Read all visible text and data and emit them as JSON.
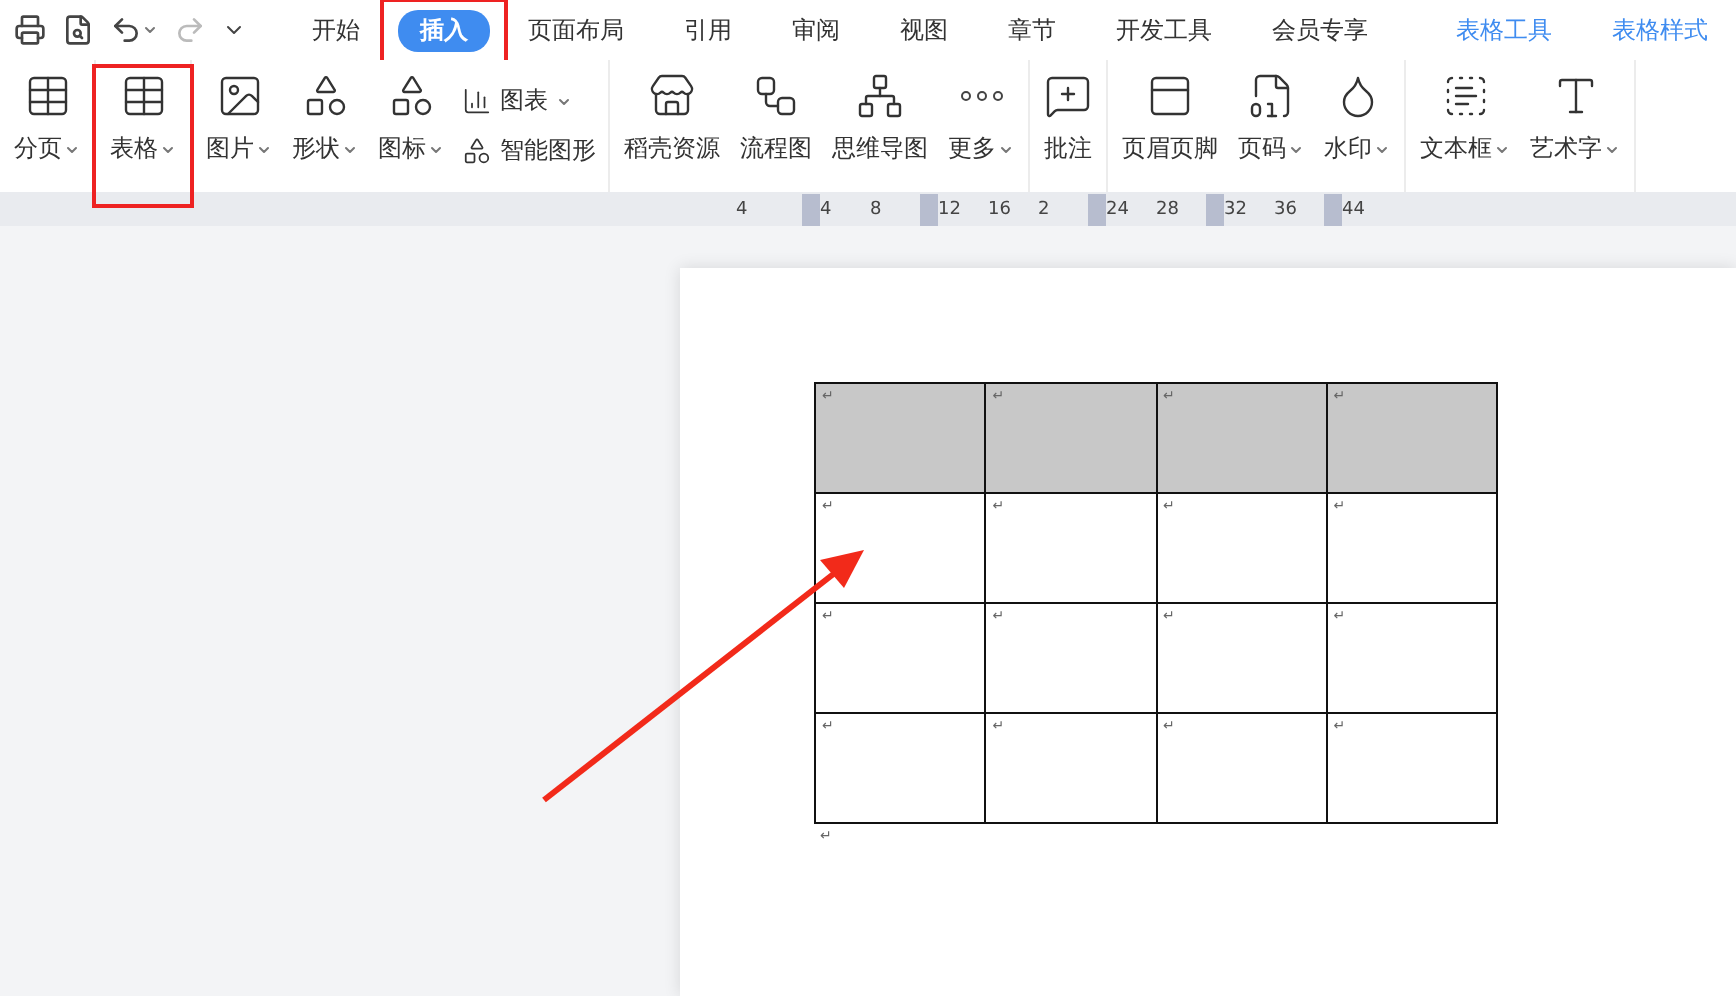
{
  "quick_access": {
    "undo_dropdown": true
  },
  "tabs": [
    {
      "label": "开始",
      "selected": false,
      "highlighted": false,
      "contextual": false
    },
    {
      "label": "插入",
      "selected": true,
      "highlighted": true,
      "contextual": false
    },
    {
      "label": "页面布局",
      "selected": false,
      "highlighted": false,
      "contextual": false
    },
    {
      "label": "引用",
      "selected": false,
      "highlighted": false,
      "contextual": false
    },
    {
      "label": "审阅",
      "selected": false,
      "highlighted": false,
      "contextual": false
    },
    {
      "label": "视图",
      "selected": false,
      "highlighted": false,
      "contextual": false
    },
    {
      "label": "章节",
      "selected": false,
      "highlighted": false,
      "contextual": false
    },
    {
      "label": "开发工具",
      "selected": false,
      "highlighted": false,
      "contextual": false
    },
    {
      "label": "会员专享",
      "selected": false,
      "highlighted": false,
      "contextual": false
    },
    {
      "label": "表格工具",
      "selected": false,
      "highlighted": false,
      "contextual": true
    },
    {
      "label": "表格样式",
      "selected": false,
      "highlighted": false,
      "contextual": true
    }
  ],
  "ribbon_groups": [
    {
      "items": [
        {
          "kind": "large",
          "label": "分页",
          "dropdown": true,
          "highlighted": false
        }
      ]
    },
    {
      "items": [
        {
          "kind": "large",
          "label": "表格",
          "dropdown": true,
          "highlighted": true
        }
      ]
    },
    {
      "items": [
        {
          "kind": "large",
          "label": "图片",
          "dropdown": true,
          "highlighted": false
        },
        {
          "kind": "large",
          "label": "形状",
          "dropdown": true,
          "highlighted": false
        },
        {
          "kind": "large",
          "label": "图标",
          "dropdown": true,
          "highlighted": false
        },
        {
          "kind": "stack",
          "items": [
            {
              "label": "图表",
              "dropdown": true
            },
            {
              "label": "智能图形",
              "dropdown": false
            }
          ]
        }
      ]
    },
    {
      "items": [
        {
          "kind": "large",
          "label": "稻壳资源",
          "dropdown": false,
          "highlighted": false
        },
        {
          "kind": "large",
          "label": "流程图",
          "dropdown": false,
          "highlighted": false
        },
        {
          "kind": "large",
          "label": "思维导图",
          "dropdown": false,
          "highlighted": false
        },
        {
          "kind": "large",
          "label": "更多",
          "dropdown": true,
          "highlighted": false
        }
      ]
    },
    {
      "items": [
        {
          "kind": "large",
          "label": "批注",
          "dropdown": false,
          "highlighted": false
        }
      ]
    },
    {
      "items": [
        {
          "kind": "large",
          "label": "页眉页脚",
          "dropdown": false,
          "highlighted": false
        },
        {
          "kind": "large",
          "label": "页码",
          "dropdown": true,
          "highlighted": false
        },
        {
          "kind": "large",
          "label": "水印",
          "dropdown": true,
          "highlighted": false
        }
      ]
    },
    {
      "items": [
        {
          "kind": "large",
          "label": "文本框",
          "dropdown": true,
          "highlighted": false
        },
        {
          "kind": "large",
          "label": "艺术字",
          "dropdown": true,
          "highlighted": false
        }
      ]
    }
  ],
  "ruler": {
    "labels": [
      "4",
      "4",
      "8",
      "12",
      "16",
      "2",
      "24",
      "28",
      "32",
      "36",
      "44"
    ]
  },
  "document": {
    "table": {
      "rows": [
        {
          "shaded": true,
          "cells": [
            "↵",
            "↵",
            "↵",
            "↵"
          ]
        },
        {
          "shaded": false,
          "cells": [
            "↵",
            "↵",
            "↵",
            "↵"
          ]
        },
        {
          "shaded": false,
          "cells": [
            "↵",
            "↵",
            "↵",
            "↵"
          ]
        },
        {
          "shaded": false,
          "cells": [
            "↵",
            "↵",
            "↵",
            "↵"
          ]
        }
      ]
    },
    "after_table_mark": "↵"
  },
  "pointer_arrow": {
    "shown": true
  }
}
